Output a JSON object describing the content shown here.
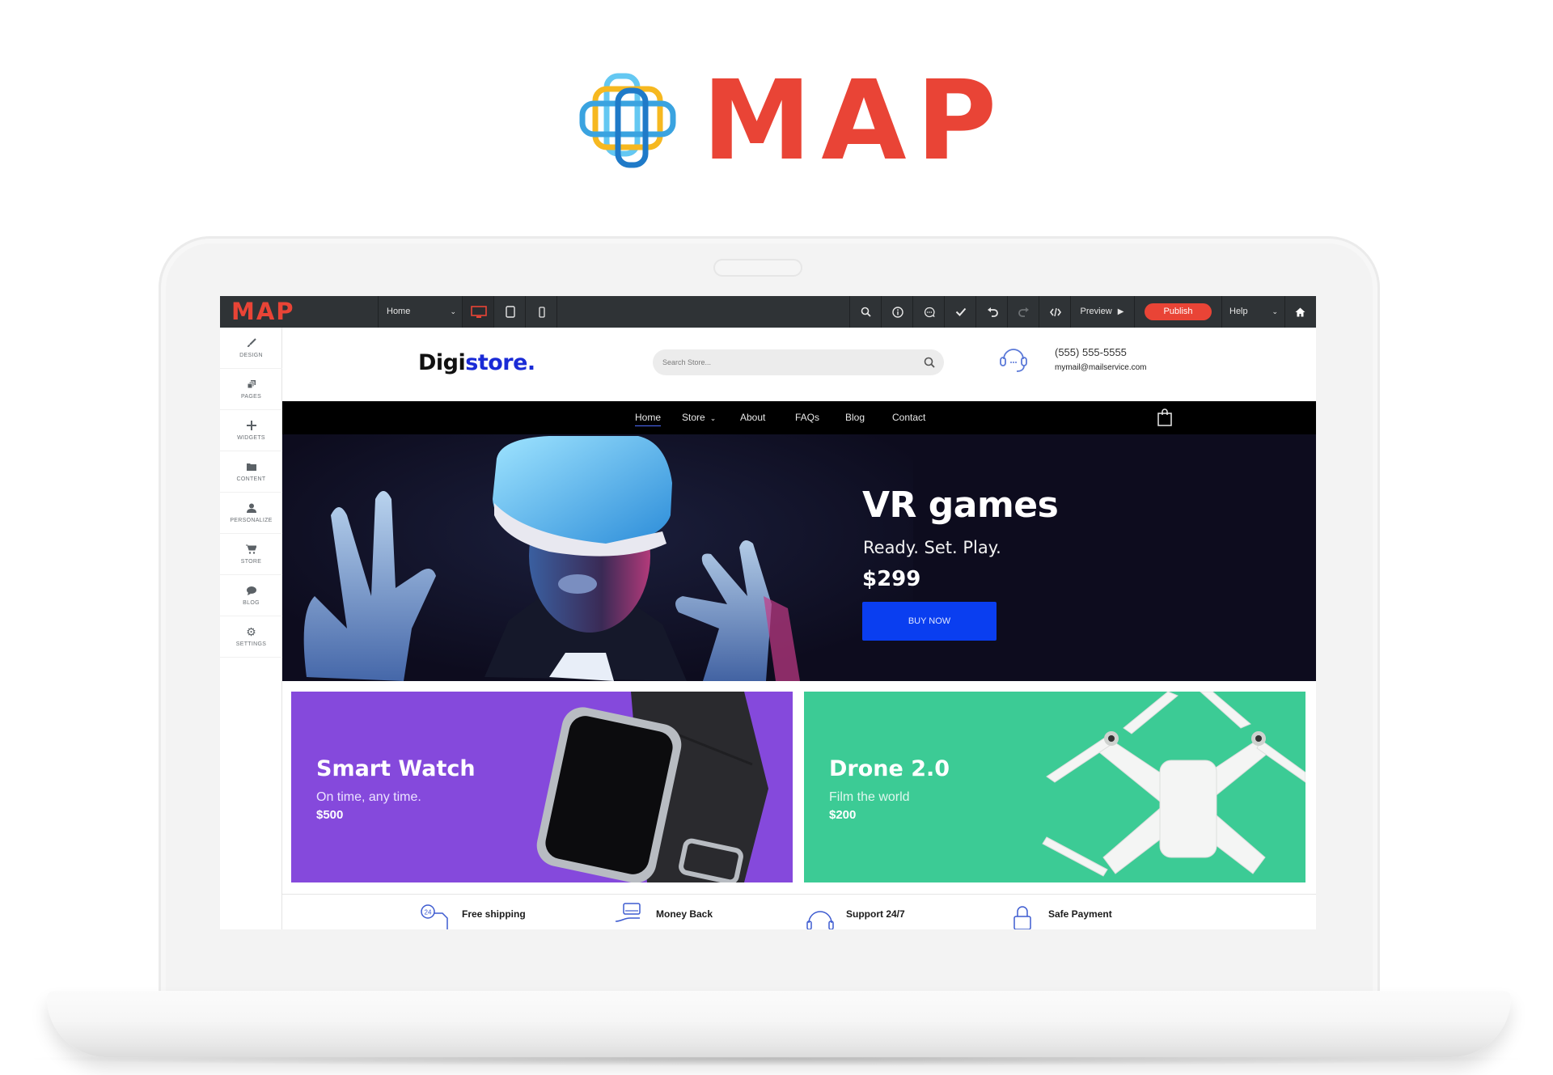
{
  "brand": {
    "name": "MAP",
    "colors": {
      "primary": "#e94436",
      "logo_blue": "#3aa3e0",
      "logo_yellow": "#f6b820"
    }
  },
  "editor": {
    "logo": "MAP",
    "page_select": {
      "value": "Home"
    },
    "device_toggles": [
      {
        "name": "desktop-icon",
        "active": true
      },
      {
        "name": "tablet-icon",
        "active": false
      },
      {
        "name": "mobile-icon",
        "active": false
      }
    ],
    "tools": [
      {
        "name": "search-icon"
      },
      {
        "name": "info-icon"
      },
      {
        "name": "comment-icon"
      },
      {
        "name": "check-icon"
      },
      {
        "name": "undo-icon"
      },
      {
        "name": "redo-icon",
        "disabled": true
      },
      {
        "name": "code-icon"
      }
    ],
    "preview_label": "Preview",
    "publish_label": "Publish",
    "help_select": {
      "value": "Help"
    },
    "home_icon": "home-icon",
    "sidebar": [
      {
        "label": "DESIGN",
        "icon": "brush-icon"
      },
      {
        "label": "PAGES",
        "icon": "pages-icon"
      },
      {
        "label": "WIDGETS",
        "icon": "plus-icon"
      },
      {
        "label": "CONTENT",
        "icon": "folder-icon"
      },
      {
        "label": "PERSONALIZE",
        "icon": "user-icon"
      },
      {
        "label": "STORE",
        "icon": "cart-icon"
      },
      {
        "label": "BLOG",
        "icon": "chat-bubble-icon"
      },
      {
        "label": "SETTINGS",
        "icon": "gear-icon"
      }
    ]
  },
  "site": {
    "logo_part1": "Digi",
    "logo_part2": "store.",
    "search_placeholder": "Search Store...",
    "phone": "(555) 555-5555",
    "email": "mymail@mailservice.com",
    "nav": [
      {
        "label": "Home",
        "active": true
      },
      {
        "label": "Store",
        "has_dropdown": true
      },
      {
        "label": "About"
      },
      {
        "label": "FAQs"
      },
      {
        "label": "Blog"
      },
      {
        "label": "Contact"
      }
    ],
    "hero": {
      "title": "VR games",
      "subtitle": "Ready. Set. Play.",
      "price": "$299",
      "button": "BUY NOW",
      "button_color": "#0a3ef0"
    },
    "promos": [
      {
        "title": "Smart Watch",
        "subtitle": "On time, any time.",
        "price": "$500",
        "color": "#8549dc"
      },
      {
        "title": "Drone 2.0",
        "subtitle": "Film the world",
        "price": "$200",
        "color": "#3ccb95"
      }
    ],
    "features": [
      {
        "label": "Free shipping",
        "icon": "shipping-24-icon"
      },
      {
        "label": "Money Back",
        "icon": "money-back-icon"
      },
      {
        "label": "Support 24/7",
        "icon": "headset-icon"
      },
      {
        "label": "Safe Payment",
        "icon": "lock-icon"
      }
    ]
  }
}
